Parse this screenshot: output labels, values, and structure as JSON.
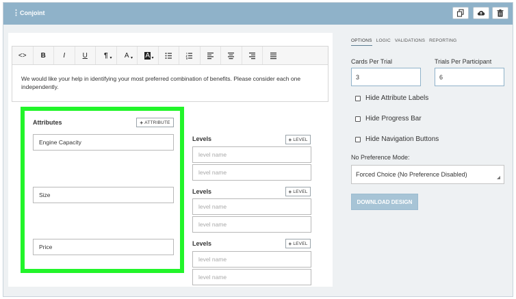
{
  "header": {
    "title": "Conjoint",
    "grip_icon": "drag-handle-icon",
    "actions": [
      {
        "name": "copy-button",
        "icon": "copy-icon"
      },
      {
        "name": "save-cloud-button",
        "icon": "cloud-upload-icon"
      },
      {
        "name": "delete-button",
        "icon": "trash-icon"
      }
    ]
  },
  "editor": {
    "toolbar": {
      "code": "<>",
      "bold": "B",
      "italic": "I",
      "underline": "U",
      "paragraph": "¶",
      "font_color": "A",
      "highlight": "A"
    },
    "body_text": "We would like your help in identifying your most preferred combination of benefits. Please consider each one independently."
  },
  "attributes": {
    "heading": "Attributes",
    "add_label": "ATTRIBUTE",
    "items": [
      {
        "name": "Engine Capacity",
        "levels_heading": "Levels",
        "add_level": "LEVEL",
        "level_placeholders": [
          "level name",
          "level name"
        ]
      },
      {
        "name": "Size",
        "levels_heading": "Levels",
        "add_level": "LEVEL",
        "level_placeholders": [
          "level name",
          "level name"
        ]
      },
      {
        "name": "Price",
        "levels_heading": "Levels",
        "add_level": "LEVEL",
        "level_placeholders": [
          "level name",
          "level name"
        ]
      }
    ]
  },
  "settings": {
    "tabs": [
      "OPTIONS",
      "LOGIC",
      "VALIDATIONS",
      "REPORTING"
    ],
    "active_tab": "OPTIONS",
    "cards_per_trial_label": "Cards Per Trial",
    "cards_per_trial_value": "3",
    "trials_per_participant_label": "Trials Per Participant",
    "trials_per_participant_value": "6",
    "checkboxes": [
      {
        "label": "Hide Attribute Labels",
        "checked": false
      },
      {
        "label": "Hide Progress Bar",
        "checked": false
      },
      {
        "label": "Hide Navigation Buttons",
        "checked": false
      }
    ],
    "no_pref_label": "No Preference Mode:",
    "no_pref_value": "Forced Choice (No Preference Disabled)",
    "download_label": "DOWNLOAD DESIGN"
  },
  "colors": {
    "header_bg": "#8fb2c9",
    "highlight_border": "#22f52a",
    "download_bg": "#a7c4d6"
  }
}
